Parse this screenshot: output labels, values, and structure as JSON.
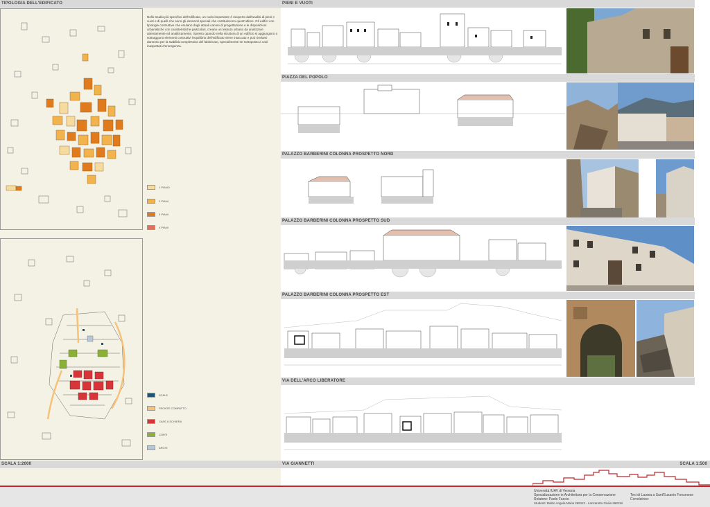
{
  "left_panel": {
    "title": "TIPOLOGIA DELL'EDIFICATO",
    "description": "Nello studio più specifico dell'edificato, un ruolo importante è ricoperto dall'analisi di pieni e vuoti e di quelli che sono gli elementi speciali che costituiscono quest'ultimo. Gli edifici con tipologie costruttive che esulano dagli attuali canoni di progettazione e le disposizioni urbanistiche con caratteristiche particolari, creano un tessuto urbano da analizzare attentamente ed analiticamente. Spesso quando nella struttura di un edificio si aggiungono o sottraggono elementi costruttivi l'equilibrio dell'edificato viene intaccato e può rivelarsi dannoso per la stabilità complessiva del fabbricato, specialmente se sottoposto a casi inaspettati d'emergenza.",
    "legend_top": [
      {
        "label": "1 PIANO",
        "color": "#f5dc9e"
      },
      {
        "label": "2 PIANI",
        "color": "#f2b34c"
      },
      {
        "label": "3 PIANI",
        "color": "#e07b1d"
      },
      {
        "label": "4 PIANI",
        "color": "#e2705a"
      }
    ],
    "legend_bottom": [
      {
        "label": "SCALE",
        "color": "#1f5573"
      },
      {
        "label": "FRONTE COMPATTO",
        "color": "#f6c27a"
      },
      {
        "label": "CASE A SCHIERA",
        "color": "#d7353a"
      },
      {
        "label": "CORTI",
        "color": "#8ab038"
      },
      {
        "label": "ARCHI",
        "color": "#b8c7d6"
      }
    ],
    "scale": "SCALA 1:2000"
  },
  "sections": [
    {
      "title": "PIENI E VUOTI"
    },
    {
      "title": "PIAZZA DEL POPOLO"
    },
    {
      "title": "PALAZZO BARBERINI COLONNA PROSPETTO NORD"
    },
    {
      "title": "PALAZZO BARBERINI COLONNA PROSPETTO SUD"
    },
    {
      "title": "PALAZZO BARBERINI COLONNA PROSPETTO EST"
    },
    {
      "title": "VIA DELL'ARCO LIBERATORE"
    },
    {
      "title": "VIA GIANNETTI"
    }
  ],
  "right_scale": "SCALA 1:500",
  "footer": {
    "line1": "Università IUAV di Venezia",
    "line2": "Specializzazione in Architettura per la Conservazione",
    "line3": "Relatore: Paolo Faccio",
    "line4": "Studenti: Baldo Angela Maria 268112 - Lanzaretto Giulia 268118",
    "thesis": "Tesi di Laurea a Sant'Eusanio Forconese",
    "correlatrice": "Correlatrice:"
  },
  "colors": {
    "accent_red": "#c0272d",
    "band_gray": "#d9d9d9",
    "paper": "#f4f1e5"
  }
}
